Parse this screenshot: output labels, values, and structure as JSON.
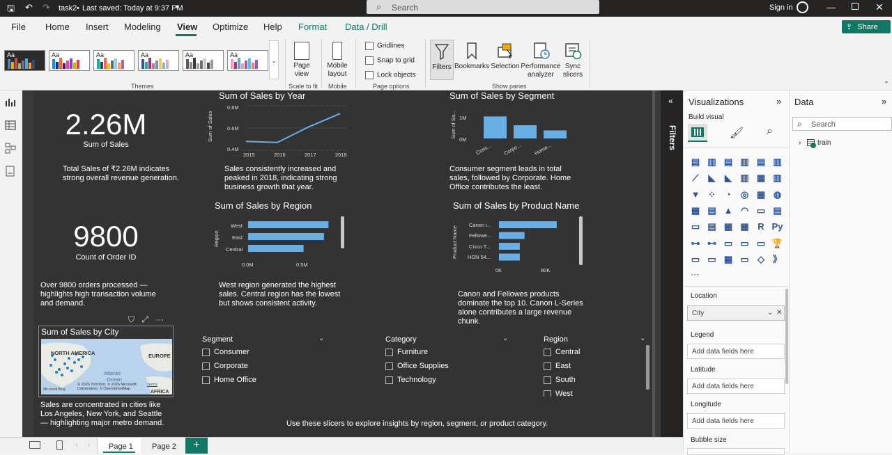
{
  "titlebar": {
    "file_name": "task2",
    "saved": "Last saved: Today at 9:37 PM",
    "search_placeholder": "Search",
    "signin": "Sign in"
  },
  "ribbon_tabs": [
    "File",
    "Home",
    "Insert",
    "Modeling",
    "View",
    "Optimize",
    "Help",
    "Format",
    "Data / Drill"
  ],
  "share_label": "Share",
  "ribbon": {
    "themes_label": "Themes",
    "theme_aa": "Aa",
    "page_view_line1": "Page",
    "page_view_line2": "view",
    "mobile_line1": "Mobile",
    "mobile_line2": "layout",
    "scale_label": "Scale to fit",
    "mobile_group": "Mobile",
    "gridlines": "Gridlines",
    "snap": "Snap to grid",
    "lock": "Lock objects",
    "page_options": "Page options",
    "filters": "Filters",
    "bookmarks": "Bookmarks",
    "selection": "Selection",
    "perf_line1": "Performance",
    "perf_line2": "analyzer",
    "sync_line1": "Sync",
    "sync_line2": "slicers",
    "show_panes": "Show panes"
  },
  "cards": [
    {
      "value": "2.26M",
      "label": "Sum of Sales",
      "desc": "Total Sales of ₹2.26M indicates strong overall revenue generation."
    },
    {
      "value": "9800",
      "label": "Count of Order ID",
      "desc": "Over 9800 orders processed — highlights high transaction volume and demand."
    }
  ],
  "charts": {
    "year": {
      "title": "Sum of Sales by Year",
      "ylabel": "Sum of Sales",
      "yticks": [
        "0.8M",
        "0.6M",
        "0.4M"
      ],
      "xticks": [
        "2015",
        "2016",
        "2017",
        "2018"
      ],
      "desc": "Sales consistently increased and peaked in 2018, indicating strong business growth that year."
    },
    "segment": {
      "title": "Sum of Sales by Segment",
      "ylabel": "Sum of Sa...",
      "yticks": [
        "1M",
        "0M"
      ],
      "xticks": [
        "Cons...",
        "Corpo...",
        "Home..."
      ],
      "desc": "Consumer segment leads in total sales, followed by Corporate. Home Office contributes the least."
    },
    "region": {
      "title": "Sum of Sales by Region",
      "ylabel": "Region",
      "cats": [
        "West",
        "East",
        "Central"
      ],
      "xticks": [
        "0.0M",
        "0.5M"
      ],
      "desc": "West region generated the highest sales. Central region has the lowest but shows consistent activity."
    },
    "product": {
      "title": "Sum of Sales by Product Name",
      "ylabel": "Product Name",
      "cats": [
        "Canon i...",
        "Fellowe...",
        "Cisco T...",
        "HON 54..."
      ],
      "xticks": [
        "0K",
        "80K"
      ],
      "desc": "Canon and Fellowes products dominate the top 10. Canon L-Series alone contributes a large revenue chunk."
    },
    "city": {
      "title": "Sum of Sales by City",
      "map_labels": [
        "NORTH AMERICA",
        "EUROPE",
        "Atlantic",
        "Ocean",
        "AFRICA"
      ],
      "attribution": "© 2026 TomTom, © 2026 Microsoft Corporation, © OpenStreetMap",
      "terms": "Terms",
      "bing": "Microsoft Bing",
      "desc": "Sales are concentrated in cities like Los Angeles, New York, and Seattle — highlighting major metro demand."
    }
  },
  "chart_data": [
    {
      "type": "line",
      "title": "Sum of Sales by Year",
      "ylabel": "Sum of Sales",
      "x": [
        2015,
        2016,
        2017,
        2018
      ],
      "values": [
        0.48,
        0.47,
        0.61,
        0.73
      ],
      "ylim": [
        0.4,
        0.8
      ]
    },
    {
      "type": "bar",
      "title": "Sum of Sales by Segment",
      "categories": [
        "Consumer",
        "Corporate",
        "Home Office"
      ],
      "values": [
        1.15,
        0.69,
        0.42
      ],
      "ylim": [
        0,
        1.6
      ]
    },
    {
      "type": "bar",
      "title": "Sum of Sales by Region",
      "categories": [
        "West",
        "East",
        "Central"
      ],
      "values": [
        0.71,
        0.67,
        0.49
      ],
      "xlim": [
        0,
        0.8
      ]
    },
    {
      "type": "bar",
      "title": "Sum of Sales by Product Name",
      "categories": [
        "Canon i...",
        "Fellowe...",
        "Cisco T...",
        "HON 54..."
      ],
      "values": [
        61,
        27,
        22,
        22
      ],
      "xlim": [
        0,
        100
      ]
    }
  ],
  "slicers": [
    {
      "title": "Segment",
      "items": [
        "Consumer",
        "Corporate",
        "Home Office"
      ]
    },
    {
      "title": "Category",
      "items": [
        "Furniture",
        "Office Supplies",
        "Technology"
      ]
    },
    {
      "title": "Region",
      "items": [
        "Central",
        "East",
        "South",
        "West"
      ]
    }
  ],
  "slicer_note": "Use these slicers to explore insights by region, segment, or product category.",
  "filters_label": "Filters",
  "viz": {
    "title": "Visualizations",
    "build": "Build visual",
    "more": "···",
    "wells": [
      {
        "label": "Location",
        "value": "City"
      },
      {
        "label": "Legend",
        "value": "Add data fields here"
      },
      {
        "label": "Latitude",
        "value": "Add data fields here"
      },
      {
        "label": "Longitude",
        "value": "Add data fields here"
      },
      {
        "label": "Bubble size",
        "value": ""
      }
    ]
  },
  "data": {
    "title": "Data",
    "search": "Search",
    "table": "train"
  },
  "pages": [
    "Page 1",
    "Page 2"
  ],
  "colors": {
    "accent": "#117865",
    "bar": "#6aafe4",
    "canvas": "#333333"
  }
}
